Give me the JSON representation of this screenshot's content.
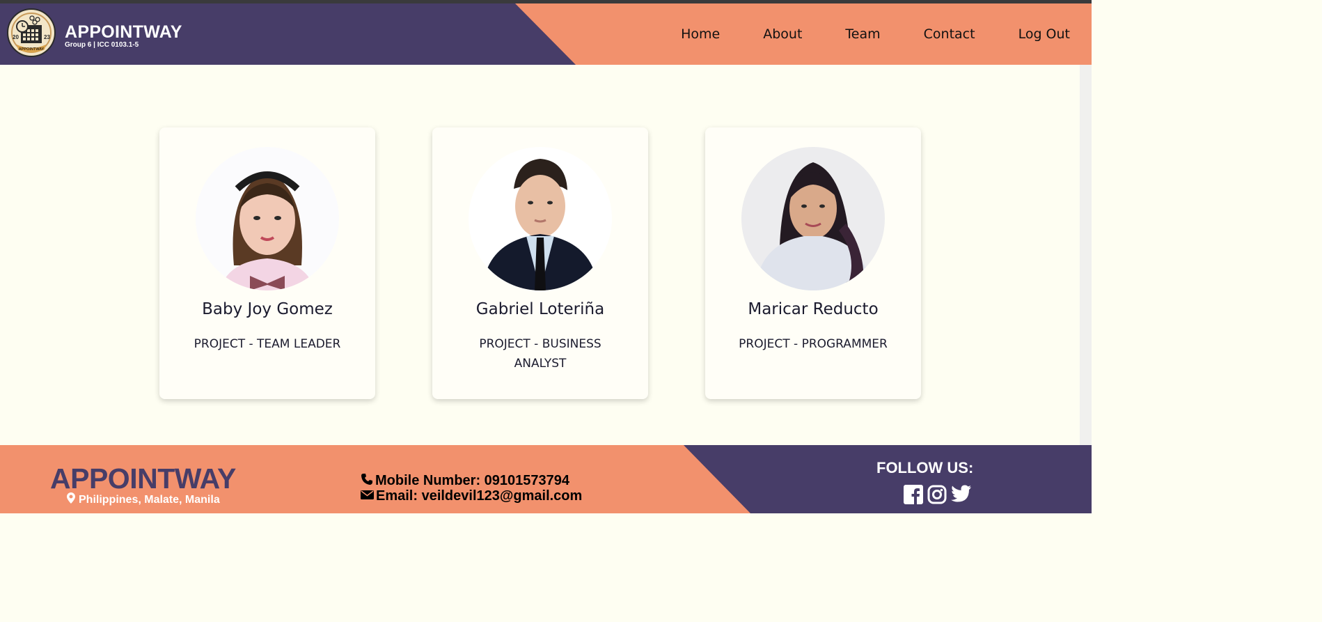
{
  "header": {
    "logo_badge_text": "APPOINTWAY",
    "logo_year_left": "20",
    "logo_year_right": "23",
    "title": "APPOINTWAY",
    "subtitle": "Group 6 | ICC 0103.1-5",
    "nav": [
      "Home",
      "About",
      "Team",
      "Contact",
      "Log Out"
    ]
  },
  "team": [
    {
      "name": "Baby Joy Gomez",
      "role": "PROJECT - TEAM LEADER"
    },
    {
      "name": "Gabriel Loteriña",
      "role": "PROJECT - BUSINESS ANALYST"
    },
    {
      "name": "Maricar Reducto",
      "role": "PROJECT - PROGRAMMER"
    }
  ],
  "footer": {
    "title": "APPOINTWAY",
    "location": "Philippines, Malate, Manila",
    "mobile": "Mobile Number: 09101573794",
    "email": "Email: veildevil123@gmail.com",
    "follow_label": "FOLLOW US:",
    "social_icons": [
      "facebook-icon",
      "instagram-icon",
      "twitter-icon"
    ]
  },
  "colors": {
    "purple": "#473d68",
    "salmon": "#f2916d",
    "page_bg": "#fefef2",
    "card_bg": "#fffef7"
  }
}
